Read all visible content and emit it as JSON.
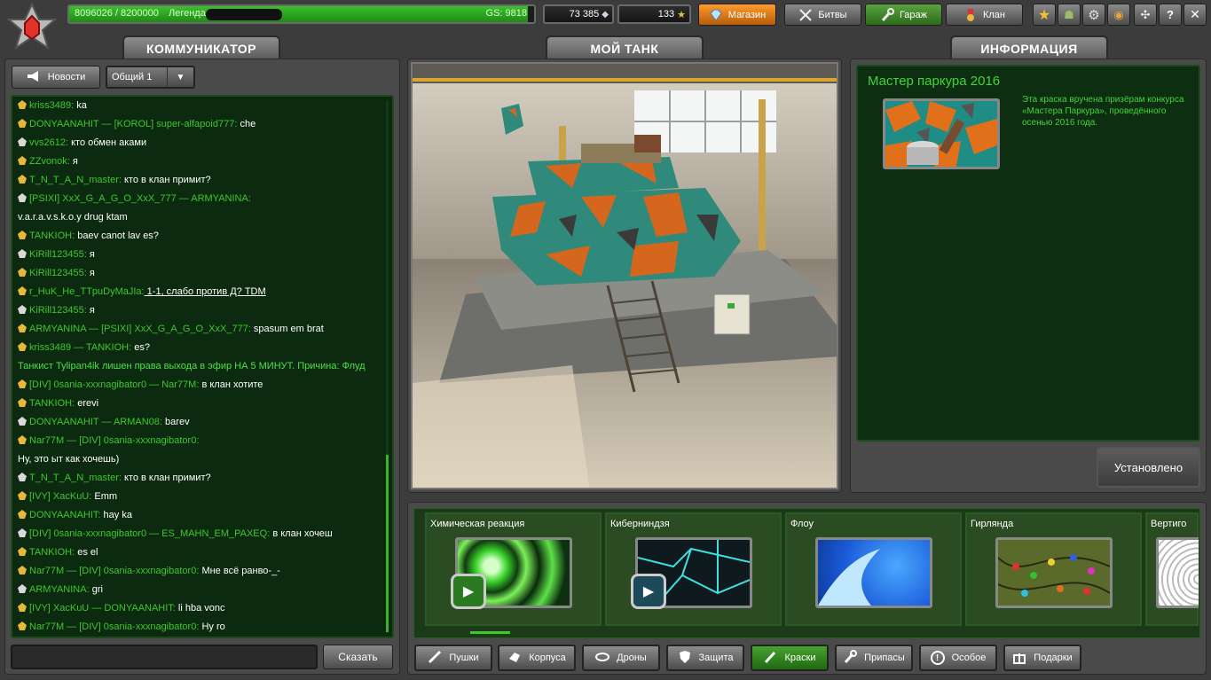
{
  "topbar": {
    "xp_text": "8096026 / 8200000",
    "rank_name": "Легенда",
    "gs_text": "GS: 9818",
    "xp_progress": 0.987,
    "crystals": "73 385",
    "stars": "133",
    "shop_label": "Магазин",
    "battles_label": "Битвы",
    "garage_label": "Гараж",
    "clan_label": "Клан"
  },
  "communicator": {
    "title": "КОММУНИКАТОР",
    "news_label": "Новости",
    "channel": "Общий 1",
    "send_label": "Сказать",
    "messages": [
      {
        "text": [
          {
            "t": "kriss3489:",
            "c": "nm"
          },
          {
            "t": " ka",
            "c": ""
          }
        ]
      },
      {
        "text": [
          {
            "t": "DONYAANAHIT",
            "c": "nm"
          },
          {
            "t": " — ",
            "c": "nm"
          },
          {
            "t": "[KOROL] super-alfapoid777:",
            "c": "nm"
          },
          {
            "t": " che",
            "c": ""
          }
        ]
      },
      {
        "text": [
          {
            "t": "vvs2612:",
            "c": "nm"
          },
          {
            "t": " кто обмен аками",
            "c": ""
          }
        ]
      },
      {
        "text": [
          {
            "t": "ZZvonok:",
            "c": "nm"
          },
          {
            "t": " я",
            "c": ""
          }
        ]
      },
      {
        "text": [
          {
            "t": "T_N_T_A_N_master:",
            "c": "nm"
          },
          {
            "t": " кто в клан примит?",
            "c": ""
          }
        ]
      },
      {
        "text": [
          {
            "t": "[PSIXI] XxX_G_A_G_O_XxX_777",
            "c": "nm"
          },
          {
            "t": " — ",
            "c": "nm"
          },
          {
            "t": "ARMYANINA:",
            "c": "nm"
          }
        ]
      },
      {
        "text": [
          {
            "t": "v.a.r.a.v.s.k.o.y drug ktam",
            "c": ""
          }
        ]
      },
      {
        "text": [
          {
            "t": "TANKIOH:",
            "c": "nm"
          },
          {
            "t": " baev canot lav es?",
            "c": ""
          }
        ]
      },
      {
        "text": [
          {
            "t": "KiRill123455:",
            "c": "nm"
          },
          {
            "t": " я",
            "c": ""
          }
        ]
      },
      {
        "text": [
          {
            "t": "KiRill123455:",
            "c": "nm"
          },
          {
            "t": " я",
            "c": ""
          }
        ]
      },
      {
        "text": [
          {
            "t": "r_HuK_He_TTpuDyMaJIa:",
            "c": "nm"
          },
          {
            "t": " 1-1, слабо против Д? TDM",
            "c": "link"
          }
        ]
      },
      {
        "text": [
          {
            "t": "KiRill123455:",
            "c": "nm"
          },
          {
            "t": " я",
            "c": ""
          }
        ]
      },
      {
        "text": [
          {
            "t": "ARMYANINA",
            "c": "nm"
          },
          {
            "t": " — ",
            "c": "nm"
          },
          {
            "t": "[PSIXI] XxX_G_A_G_O_XxX_777:",
            "c": "nm"
          },
          {
            "t": " spasum em brat",
            "c": ""
          }
        ]
      },
      {
        "text": [
          {
            "t": "kriss3489",
            "c": "nm"
          },
          {
            "t": " — ",
            "c": "nm"
          },
          {
            "t": "TANKIOH:",
            "c": "nm"
          },
          {
            "t": " es?",
            "c": ""
          }
        ]
      },
      {
        "text": [
          {
            "t": "Танкист Tylipan4ik лишен  права выхода в эфир НА 5 МИНУТ. Причина: Флуд",
            "c": "sys"
          }
        ]
      },
      {
        "text": [
          {
            "t": "[DIV] 0sania-xxxnagibator0",
            "c": "nm"
          },
          {
            "t": " — ",
            "c": "nm"
          },
          {
            "t": "Nar77M:",
            "c": "nm"
          },
          {
            "t": " в клан хотите",
            "c": ""
          }
        ]
      },
      {
        "text": [
          {
            "t": "TANKIOH:",
            "c": "nm"
          },
          {
            "t": " erevi",
            "c": ""
          }
        ]
      },
      {
        "text": [
          {
            "t": "DONYAANAHIT",
            "c": "nm"
          },
          {
            "t": " — ",
            "c": "nm"
          },
          {
            "t": "ARMAN08:",
            "c": "nm"
          },
          {
            "t": " barev",
            "c": ""
          }
        ]
      },
      {
        "text": [
          {
            "t": "Nar77M",
            "c": "nm"
          },
          {
            "t": " — ",
            "c": "nm"
          },
          {
            "t": "[DIV] 0sania-xxxnagibator0:",
            "c": "nm"
          }
        ]
      },
      {
        "text": [
          {
            "t": "Ну, это ыт как хочешь)",
            "c": ""
          }
        ]
      },
      {
        "text": [
          {
            "t": "T_N_T_A_N_master:",
            "c": "nm"
          },
          {
            "t": " кто в клан примит?",
            "c": ""
          }
        ]
      },
      {
        "text": [
          {
            "t": "[IVY] XacKuU:",
            "c": "nm"
          },
          {
            "t": " Emm",
            "c": ""
          }
        ]
      },
      {
        "text": [
          {
            "t": "DONYAANAHIT:",
            "c": "nm"
          },
          {
            "t": " hay ka",
            "c": ""
          }
        ]
      },
      {
        "text": [
          {
            "t": "[DIV] 0sania-xxxnagibator0",
            "c": "nm"
          },
          {
            "t": " — ",
            "c": "nm"
          },
          {
            "t": "ES_MAHN_EM_PAXEQ:",
            "c": "nm"
          },
          {
            "t": " в клан хочеш",
            "c": ""
          }
        ]
      },
      {
        "text": [
          {
            "t": "TANKIOH:",
            "c": "nm"
          },
          {
            "t": " es el",
            "c": ""
          }
        ]
      },
      {
        "text": [
          {
            "t": "Nar77M",
            "c": "nm"
          },
          {
            "t": " — ",
            "c": "nm"
          },
          {
            "t": "[DIV] 0sania-xxxnagibator0:",
            "c": "nm"
          },
          {
            "t": " Мне всё ранво-_-",
            "c": ""
          }
        ]
      },
      {
        "text": [
          {
            "t": "ARMYANINA:",
            "c": "nm"
          },
          {
            "t": " gri",
            "c": ""
          }
        ]
      },
      {
        "text": [
          {
            "t": "[IVY] XacKuU",
            "c": "nm"
          },
          {
            "t": " — ",
            "c": "nm"
          },
          {
            "t": "DONYAANAHIT:",
            "c": "nm"
          },
          {
            "t": " li hba vonc",
            "c": ""
          }
        ]
      },
      {
        "text": [
          {
            "t": "Nar77M",
            "c": "nm"
          },
          {
            "t": " — ",
            "c": "nm"
          },
          {
            "t": "[DIV] 0sania-xxxnagibator0:",
            "c": "nm"
          },
          {
            "t": " Hy ro",
            "c": ""
          }
        ]
      }
    ]
  },
  "mytank": {
    "title": "МОЙ ТАНК"
  },
  "info": {
    "title": "ИНФОРМАЦИЯ",
    "item_name": "Мастер паркура 2016",
    "description": "Эта краска вручена призёрам конкурса «Мастера Паркура», проведённого осенью 2016 года.",
    "installed_label": "Установлено"
  },
  "paints": [
    {
      "name": "Химическая реакция"
    },
    {
      "name": "Киберниндзя"
    },
    {
      "name": "Флоу"
    },
    {
      "name": "Гирлянда"
    },
    {
      "name": "Вертиго"
    }
  ],
  "categories": [
    {
      "label": "Пушки"
    },
    {
      "label": "Корпуса"
    },
    {
      "label": "Дроны"
    },
    {
      "label": "Защита"
    },
    {
      "label": "Краски"
    },
    {
      "label": "Припасы"
    },
    {
      "label": "Особое"
    },
    {
      "label": "Подарки"
    }
  ],
  "colors": {
    "accent_green": "#3ec82e",
    "panel_bg": "#4a4a4a",
    "chat_bg": "#0c2a10"
  }
}
